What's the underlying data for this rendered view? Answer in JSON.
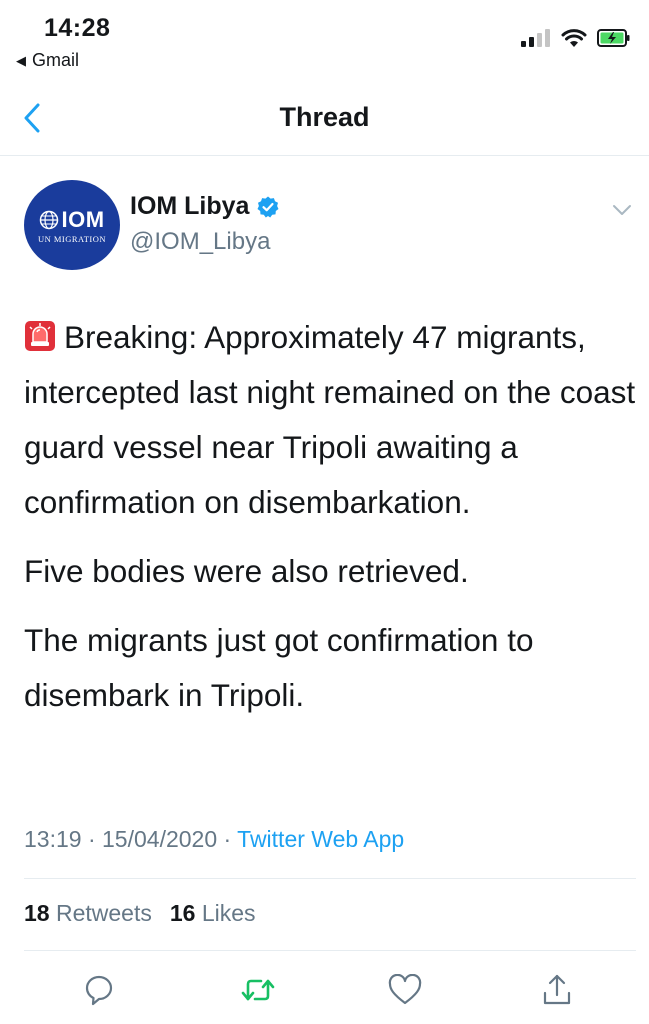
{
  "status_bar": {
    "time": "14:28",
    "back_app": "Gmail",
    "icons": [
      "signal-icon",
      "wifi-icon",
      "battery-charging-icon"
    ]
  },
  "nav": {
    "title": "Thread",
    "back_icon": "chevron-left-icon"
  },
  "tweet": {
    "author": {
      "display_name": "IOM Libya",
      "handle": "@IOM_Libya",
      "verified": true,
      "avatar_text": "IOM",
      "avatar_subtext": "UN MIGRATION"
    },
    "paragraphs": [
      "Breaking: Approximately 47 migrants, intercepted last night remained on the coast guard vessel near Tripoli awaiting a confirmation on disembarkation.",
      "Five bodies were also retrieved.",
      "The migrants just got confirmation to disembark in Tripoli."
    ],
    "emoji": "rotating-light-icon",
    "time": "13:19",
    "date": "15/04/2020",
    "source": "Twitter Web App",
    "retweets_count": "18",
    "retweets_label": "Retweets",
    "likes_count": "16",
    "likes_label": "Likes"
  },
  "actions": [
    "reply-icon",
    "retweet-icon",
    "like-icon",
    "share-icon"
  ],
  "colors": {
    "accent": "#1da1f2",
    "retweet_green": "#17bf63",
    "secondary_text": "#657786",
    "avatar_bg": "#1a3c9c"
  }
}
